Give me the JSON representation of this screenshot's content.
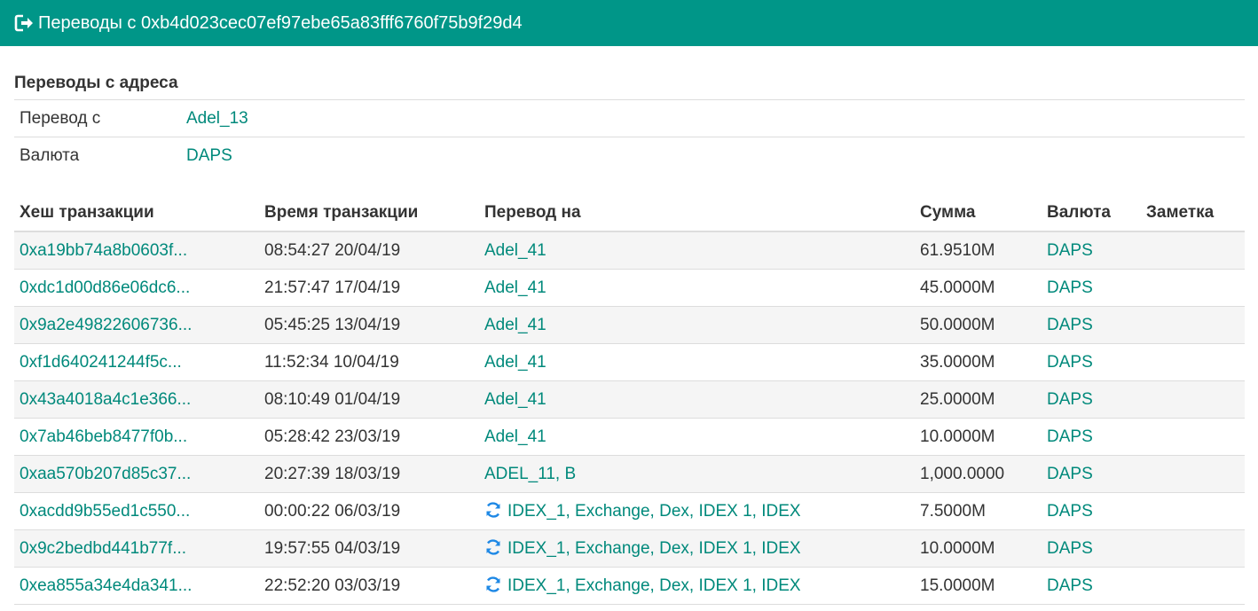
{
  "header": {
    "icon": "sign-out-icon",
    "title": "Переводы с 0xb4d023cec07ef97ebe65a83fff6760f75b9f29d4"
  },
  "summary": {
    "title": "Переводы с адреса",
    "rows": [
      {
        "key": "Перевод с",
        "value": "Adel_13"
      },
      {
        "key": "Валюта",
        "value": "DAPS"
      }
    ]
  },
  "transactions": {
    "columns": [
      "Хеш транзакции",
      "Время транзакции",
      "Перевод на",
      "Сумма",
      "Валюта",
      "Заметка"
    ],
    "rows": [
      {
        "hash": "0xa19bb74a8b0603f...",
        "time": "08:54:27 20/04/19",
        "to": "Adel_41",
        "exchange": false,
        "amount": "61.9510M",
        "currency": "DAPS",
        "note": ""
      },
      {
        "hash": "0xdc1d00d86e06dc6...",
        "time": "21:57:47 17/04/19",
        "to": "Adel_41",
        "exchange": false,
        "amount": "45.0000M",
        "currency": "DAPS",
        "note": ""
      },
      {
        "hash": "0x9a2e49822606736...",
        "time": "05:45:25 13/04/19",
        "to": "Adel_41",
        "exchange": false,
        "amount": "50.0000M",
        "currency": "DAPS",
        "note": ""
      },
      {
        "hash": "0xf1d640241244f5c...",
        "time": "11:52:34 10/04/19",
        "to": "Adel_41",
        "exchange": false,
        "amount": "35.0000M",
        "currency": "DAPS",
        "note": ""
      },
      {
        "hash": "0x43a4018a4c1e366...",
        "time": "08:10:49 01/04/19",
        "to": "Adel_41",
        "exchange": false,
        "amount": "25.0000M",
        "currency": "DAPS",
        "note": ""
      },
      {
        "hash": "0x7ab46beb8477f0b...",
        "time": "05:28:42 23/03/19",
        "to": "Adel_41",
        "exchange": false,
        "amount": "10.0000M",
        "currency": "DAPS",
        "note": ""
      },
      {
        "hash": "0xaa570b207d85c37...",
        "time": "20:27:39 18/03/19",
        "to": "ADEL_11, B",
        "exchange": false,
        "amount": "1,000.0000",
        "currency": "DAPS",
        "note": ""
      },
      {
        "hash": "0xacdd9b55ed1c550...",
        "time": "00:00:22 06/03/19",
        "to": "IDEX_1, Exchange, Dex, IDEX 1, IDEX",
        "exchange": true,
        "amount": "7.5000M",
        "currency": "DAPS",
        "note": ""
      },
      {
        "hash": "0x9c2bedbd441b77f...",
        "time": "19:57:55 04/03/19",
        "to": "IDEX_1, Exchange, Dex, IDEX 1, IDEX",
        "exchange": true,
        "amount": "10.0000M",
        "currency": "DAPS",
        "note": ""
      },
      {
        "hash": "0xea855a34e4da341...",
        "time": "22:52:20 03/03/19",
        "to": "IDEX_1, Exchange, Dex, IDEX 1, IDEX",
        "exchange": true,
        "amount": "15.0000M",
        "currency": "DAPS",
        "note": ""
      }
    ]
  },
  "colors": {
    "accent": "#009688",
    "link": "#00897b",
    "exchange_icon": "#1e88e5"
  }
}
